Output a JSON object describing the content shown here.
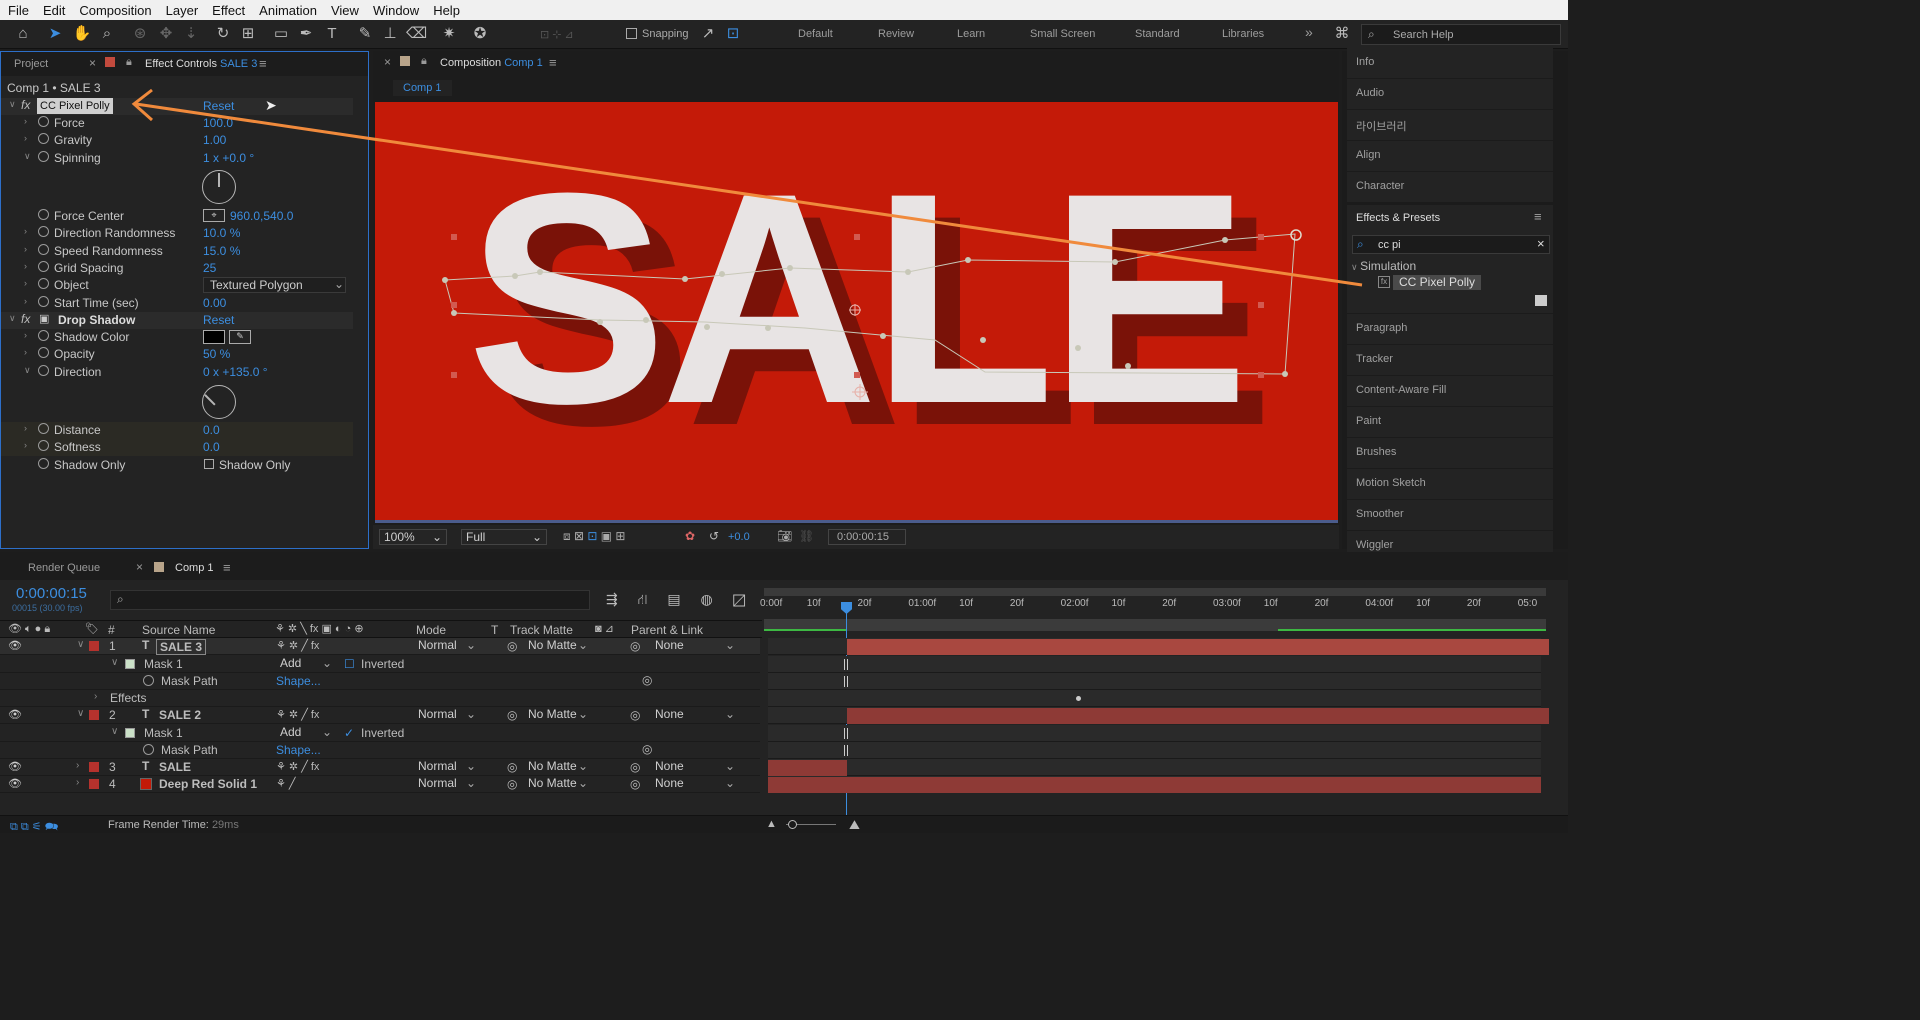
{
  "menu": [
    "File",
    "Edit",
    "Composition",
    "Layer",
    "Effect",
    "Animation",
    "View",
    "Window",
    "Help"
  ],
  "toolbar": {
    "snapping_label": "Snapping",
    "workspaces": [
      "Default",
      "Review",
      "Learn",
      "Small Screen",
      "Standard",
      "Libraries"
    ],
    "more": "»",
    "search_placeholder": "Search Help"
  },
  "left_panel": {
    "tab_project": "Project",
    "tab_effect_controls": "Effect Controls",
    "tab_effect_controls_layer": "SALE 3",
    "breadcrumb": "Comp 1 • SALE 3",
    "effect1": {
      "name": "CC Pixel Polly",
      "reset": "Reset"
    },
    "props1": [
      {
        "label": "Force",
        "value": "100.0"
      },
      {
        "label": "Gravity",
        "value": "1.00"
      },
      {
        "label": "Spinning",
        "value": "1 x +0.0 °"
      }
    ],
    "props1b": [
      {
        "label": "Force Center",
        "value": "960.0,540.0"
      },
      {
        "label": "Direction Randomness",
        "value": "10.0 %"
      },
      {
        "label": "Speed Randomness",
        "value": "15.0 %"
      },
      {
        "label": "Grid Spacing",
        "value": "25"
      },
      {
        "label": "Object",
        "value": "Textured Polygon"
      },
      {
        "label": "Start Time (sec)",
        "value": "0.00"
      }
    ],
    "effect2": {
      "name": "Drop Shadow",
      "reset": "Reset"
    },
    "props2": [
      {
        "label": "Shadow Color",
        "value": ""
      },
      {
        "label": "Opacity",
        "value": "50 %"
      },
      {
        "label": "Direction",
        "value": "0 x +135.0 °"
      }
    ],
    "props2b": [
      {
        "label": "Distance",
        "value": "0.0"
      },
      {
        "label": "Softness",
        "value": "0.0"
      },
      {
        "label": "Shadow Only",
        "value": "Shadow Only"
      }
    ]
  },
  "comp_panel": {
    "tab_label": "Composition",
    "tab_comp": "Comp 1",
    "subtab": "Comp 1",
    "canvas_text": "SALE",
    "canvas_color": "#c41a08",
    "zoom": "100%",
    "quality": "Full",
    "exposure": "+0.0",
    "timecode": "0:00:00:15"
  },
  "right_panel": {
    "items_top": [
      "Info",
      "Audio",
      "라이브러리",
      "Align",
      "Character"
    ],
    "effects_title": "Effects & Presets",
    "search_value": "cc pi",
    "category": "Simulation",
    "result": "CC Pixel Polly",
    "items_bottom": [
      "Paragraph",
      "Tracker",
      "Content-Aware Fill",
      "Paint",
      "Brushes",
      "Motion Sketch",
      "Smoother",
      "Wiggler"
    ]
  },
  "timeline": {
    "tab_render_queue": "Render Queue",
    "tab_comp": "Comp 1",
    "current_time": "0:00:00:15",
    "frame_info": "00015 (30.00 fps)",
    "columns": {
      "num": "#",
      "source": "Source Name",
      "mode": "Mode",
      "t": "T",
      "track_matte": "Track Matte",
      "parent": "Parent & Link"
    },
    "ruler": [
      "0:00f",
      "10f",
      "20f",
      "01:00f",
      "10f",
      "20f",
      "02:00f",
      "10f",
      "20f",
      "03:00f",
      "10f",
      "20f",
      "04:00f",
      "10f",
      "20f",
      "05:0"
    ],
    "layers": [
      {
        "num": "1",
        "name": "SALE 3",
        "mode": "Normal",
        "matte": "No Matte",
        "parent": "None",
        "color": "#b5322d"
      },
      {
        "num": "2",
        "name": "SALE 2",
        "mode": "Normal",
        "matte": "No Matte",
        "parent": "None",
        "color": "#b5322d"
      },
      {
        "num": "3",
        "name": "SALE",
        "mode": "Normal",
        "matte": "No Matte",
        "parent": "None",
        "color": "#b5322d"
      },
      {
        "num": "4",
        "name": "Deep Red Solid 1",
        "mode": "Normal",
        "matte": "No Matte",
        "parent": "None",
        "color": "#b5322d"
      }
    ],
    "mask_label": "Mask 1",
    "mask_mode": "Add",
    "inverted": "Inverted",
    "mask_path": "Mask Path",
    "shape": "Shape...",
    "effects_label": "Effects",
    "status_label": "Frame Render Time:",
    "status_value": "29ms"
  }
}
